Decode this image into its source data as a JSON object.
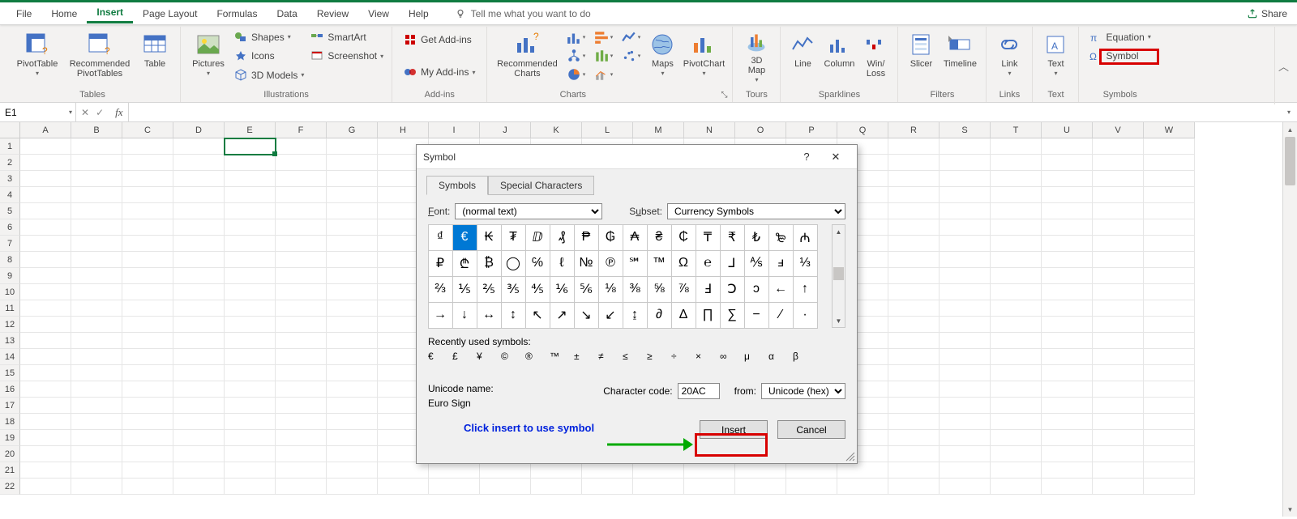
{
  "menubar": {
    "tabs": [
      "File",
      "Home",
      "Insert",
      "Page Layout",
      "Formulas",
      "Data",
      "Review",
      "View",
      "Help"
    ],
    "activeIndex": 2,
    "tellme": "Tell me what you want to do",
    "share": "Share"
  },
  "ribbon": {
    "groups": {
      "tables": {
        "label": "Tables",
        "pivottable": "PivotTable",
        "recommended": "Recommended\nPivotTables",
        "table": "Table"
      },
      "illustrations": {
        "label": "Illustrations",
        "pictures": "Pictures",
        "shapes": "Shapes",
        "icons": "Icons",
        "models": "3D Models",
        "smartart": "SmartArt",
        "screenshot": "Screenshot"
      },
      "addins": {
        "label": "Add-ins",
        "get": "Get Add-ins",
        "my": "My Add-ins"
      },
      "charts": {
        "label": "Charts",
        "recommended": "Recommended\nCharts",
        "maps": "Maps",
        "pivotchart": "PivotChart"
      },
      "tours": {
        "label": "Tours",
        "map3d": "3D\nMap"
      },
      "sparklines": {
        "label": "Sparklines",
        "line": "Line",
        "column": "Column",
        "winloss": "Win/\nLoss"
      },
      "filters": {
        "label": "Filters",
        "slicer": "Slicer",
        "timeline": "Timeline"
      },
      "links": {
        "label": "Links",
        "link": "Link"
      },
      "text": {
        "label": "Text",
        "text": "Text"
      },
      "symbols": {
        "label": "Symbols",
        "equation": "Equation",
        "symbol": "Symbol"
      }
    }
  },
  "formulaBar": {
    "activeCell": "E1",
    "fx": "fx"
  },
  "grid": {
    "columns": [
      "A",
      "B",
      "C",
      "D",
      "E",
      "F",
      "G",
      "H",
      "I",
      "J",
      "K",
      "L",
      "M",
      "N",
      "O",
      "P",
      "Q",
      "R",
      "S",
      "T",
      "U",
      "V",
      "W"
    ],
    "rows": 22,
    "activeCol": 4,
    "activeRow": 0
  },
  "dialog": {
    "title": "Symbol",
    "tabs": {
      "symbols": "Symbols",
      "special": "Special Characters"
    },
    "font_label": "Font:",
    "font_value": "(normal text)",
    "subset_label": "Subset:",
    "subset_value": "Currency Symbols",
    "symbols_grid": [
      "₫",
      "€",
      "₭",
      "₮",
      "ⅅ",
      "₰",
      "₱",
      "₲",
      "₳",
      "₴",
      "₵",
      "₸",
      "₹",
      "₺",
      "₻",
      "₼",
      "₽",
      "₾",
      "₿",
      "◯",
      "℅",
      "ℓ",
      "№",
      "℗",
      "℠",
      "™",
      "Ω",
      "℮",
      "⅃",
      "⅍",
      "ⅎ",
      "⅓",
      "⅔",
      "⅕",
      "⅖",
      "⅗",
      "⅘",
      "⅙",
      "⅚",
      "⅛",
      "⅜",
      "⅝",
      "⅞",
      "Ⅎ",
      "Ↄ",
      "ↄ",
      "←",
      "↑",
      "→",
      "↓",
      "↔",
      "↕",
      "↖",
      "↗",
      "↘",
      "↙",
      "↨",
      "∂",
      "∆",
      "∏",
      "∑",
      "−",
      "∕",
      "·"
    ],
    "selected_index": 1,
    "recent_label": "Recently used symbols:",
    "recent": [
      "€",
      "£",
      "¥",
      "©",
      "®",
      "™",
      "±",
      "≠",
      "≤",
      "≥",
      "÷",
      "×",
      "∞",
      "μ",
      "α",
      "β"
    ],
    "unicode_name_label": "Unicode name:",
    "unicode_name": "Euro Sign",
    "charcode_label": "Character code:",
    "charcode_value": "20AC",
    "from_label": "from:",
    "from_value": "Unicode (hex)",
    "insert": "Insert",
    "cancel": "Cancel",
    "note": "Click insert to use symbol"
  }
}
